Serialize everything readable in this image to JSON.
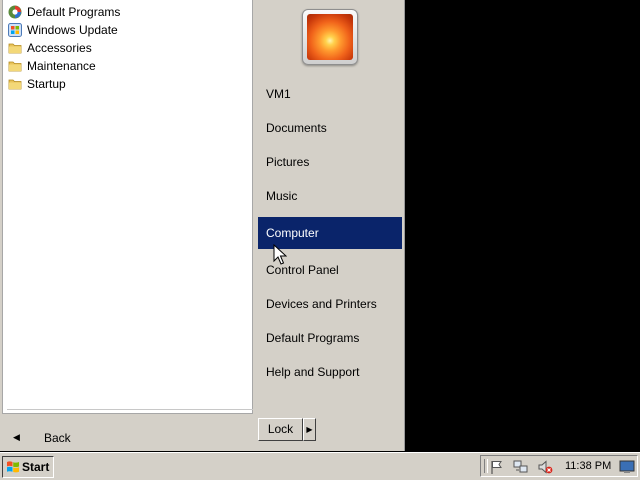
{
  "start_menu": {
    "programs": [
      {
        "label": "Default Programs",
        "icon": "default-programs-icon"
      },
      {
        "label": "Windows Update",
        "icon": "windows-update-icon"
      },
      {
        "label": "Accessories",
        "icon": "folder-icon"
      },
      {
        "label": "Maintenance",
        "icon": "folder-icon"
      },
      {
        "label": "Startup",
        "icon": "folder-icon"
      }
    ],
    "back_label": "Back",
    "places": [
      {
        "label": "VM1"
      },
      {
        "label": "Documents"
      },
      {
        "label": "Pictures"
      },
      {
        "label": "Music"
      },
      {
        "label": "Computer",
        "selected": true
      },
      {
        "label": "Control Panel"
      },
      {
        "label": "Devices and Printers"
      },
      {
        "label": "Default Programs"
      },
      {
        "label": "Help and Support"
      }
    ],
    "lock_label": "Lock"
  },
  "taskbar": {
    "start_label": "Start",
    "clock": "11:38 PM",
    "tray_icons": [
      "action-center-flag-icon",
      "network-icon",
      "volume-muted-icon",
      "show-desktop-icon"
    ]
  },
  "colors": {
    "selection": "#0a246a",
    "chrome": "#d4d0c8",
    "desktop": "#000000"
  }
}
